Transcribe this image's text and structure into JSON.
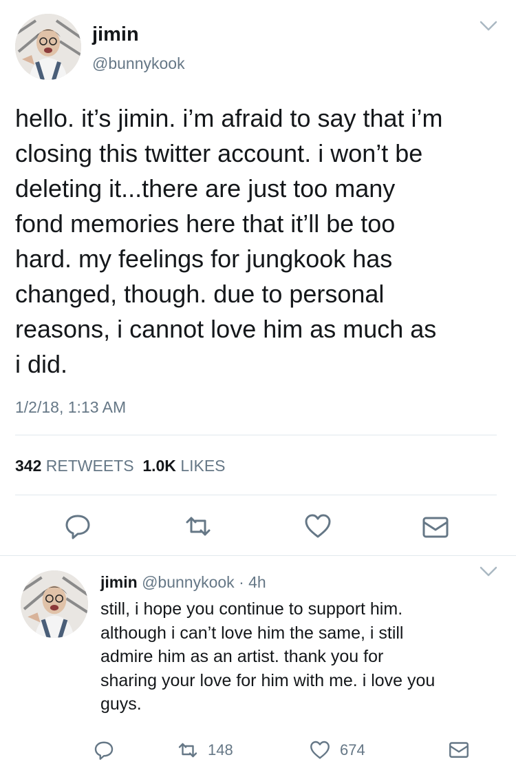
{
  "main_tweet": {
    "display_name": "jimin",
    "handle": "@bunnykook",
    "text": "hello. it’s jimin. i’m afraid to say that i’m\nclosing this twitter account. i won’t be\ndeleting it...there are just too many\nfond memories here that it’ll be too\nhard. my feelings for jungkook has\nchanged, though. due to personal\nreasons, i cannot love him as much as\ni did.",
    "timestamp": "1/2/18, 1:13 AM",
    "retweets_count": "342",
    "retweets_label": "RETWEETS",
    "likes_count": "1.0K",
    "likes_label": "LIKES"
  },
  "reply_tweet": {
    "display_name": "jimin",
    "handle": "@bunnykook",
    "separator": "·",
    "age": "4h",
    "text": "still, i hope you continue to support him.\nalthough i can’t love him the same, i still\nadmire him as an artist. thank you for\nsharing your love for him with me. i love you\nguys.",
    "retweet_count": "148",
    "like_count": "674"
  },
  "icons": [
    "chevron-down-icon",
    "reply-icon",
    "retweet-icon",
    "heart-icon",
    "message-icon",
    "avatar"
  ],
  "colors": {
    "text": "#14171a",
    "secondary": "#657786",
    "divider": "#e1e8ed",
    "icon": "#657786"
  }
}
